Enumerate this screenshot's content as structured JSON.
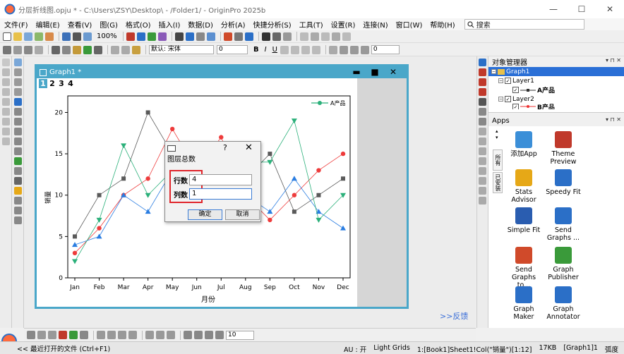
{
  "window": {
    "title": "分层折线图.opju * - C:\\Users\\ZSY\\Desktop\\ - /Folder1/ - OriginPro 2025b",
    "min_label": "—",
    "max_label": "☐",
    "close_label": "✕"
  },
  "menu": {
    "items": [
      "文件(F)",
      "编辑(E)",
      "查看(V)",
      "图(G)",
      "格式(O)",
      "插入(I)",
      "数据(D)",
      "分析(A)",
      "快捷分析(S)",
      "工具(T)",
      "设置(R)",
      "连接(N)",
      "窗口(W)",
      "帮助(H)"
    ],
    "search_label": "搜索"
  },
  "toolbar": {
    "zoom": "100%",
    "font_combo": "默认: 宋体",
    "size_combo": "0",
    "size_combo2": "0",
    "text_b": "B",
    "text_i": "I",
    "text_u": "U"
  },
  "graph_window": {
    "title": "Graph1 *",
    "min_label": "▬",
    "max_label": "■",
    "close_label": "✕",
    "layer_tabs": [
      "1",
      "2",
      "3",
      "4"
    ]
  },
  "chart_data": {
    "type": "line",
    "categories": [
      "Jan",
      "Feb",
      "Mar",
      "Apr",
      "May",
      "Jun",
      "Jul",
      "Aug",
      "Sep",
      "Oct",
      "Nov",
      "Dec"
    ],
    "xlabel": "月份",
    "ylabel": "销量",
    "ylim": [
      0,
      22
    ],
    "yticks": [
      0,
      5,
      10,
      15,
      20
    ],
    "legend_label": "A产品",
    "legend_placement": "top-right",
    "grid": false,
    "series": [
      {
        "name": "",
        "color": "#5a5a5a",
        "marker": "square",
        "values": [
          5,
          10,
          12,
          20,
          15,
          11,
          16,
          12,
          15,
          8,
          10,
          12
        ]
      },
      {
        "name": "",
        "color": "#ee3b3b",
        "marker": "circle",
        "values": [
          3,
          6,
          10,
          12,
          18,
          13,
          17,
          10,
          7,
          10,
          13,
          15
        ]
      },
      {
        "name": "",
        "color": "#2a7de1",
        "marker": "triangle-up",
        "values": [
          4,
          5,
          10,
          8,
          13,
          11,
          9,
          10,
          8,
          12,
          8,
          6
        ]
      },
      {
        "name": "",
        "color": "#2bb07a",
        "marker": "triangle-down",
        "values": [
          2,
          7,
          16,
          10,
          13,
          11,
          11,
          14,
          14,
          19,
          7,
          10
        ]
      }
    ]
  },
  "dialog": {
    "title": "图层总数",
    "help_label": "?",
    "close_label": "✕",
    "rows_label": "行数",
    "rows_value": "4",
    "cols_label": "列数",
    "cols_value": "1",
    "ok_label": "确定",
    "cancel_label": "取消"
  },
  "feedback_label": ">>反馈",
  "object_manager": {
    "title": "对象管理器",
    "ctrls": "▾ ⊓ ✕",
    "graph": "Graph1",
    "layer1": "Layer1",
    "plot1": "A产品",
    "layer2": "Layer2",
    "plot2": "B产品"
  },
  "apps": {
    "title": "Apps",
    "ctrls": "▾ ⊓ ✕",
    "vtab1": "所有",
    "vtab2": "已安装",
    "items": [
      {
        "label": "添加App",
        "color": "#3b8fd8"
      },
      {
        "label": "Theme Preview",
        "color": "#c0392b"
      },
      {
        "label": "Stats Advisor",
        "color": "#e6a817"
      },
      {
        "label": "Speedy Fit",
        "color": "#2b6fc7"
      },
      {
        "label": "Simple Fit",
        "color": "#2a5db0"
      },
      {
        "label": "Send Graphs ...",
        "color": "#2b6fc7"
      },
      {
        "label": "Send Graphs to...",
        "color": "#d04a2a"
      },
      {
        "label": "Graph Publisher",
        "color": "#3a9a3a"
      },
      {
        "label": "Graph Maker",
        "color": "#2b6fc7"
      },
      {
        "label": "Graph Annotator",
        "color": "#2b6fc7"
      }
    ]
  },
  "status": {
    "recent": "<< 最近打开的文件 (Ctrl+F1)",
    "au": "AU : 开",
    "grids": "Light Grids",
    "ref": "1:[Book1]Sheet1!Col(\"销量\")[1:12]",
    "size": "17KB",
    "graph": "[Graph1]1",
    "angle": "弧度"
  }
}
